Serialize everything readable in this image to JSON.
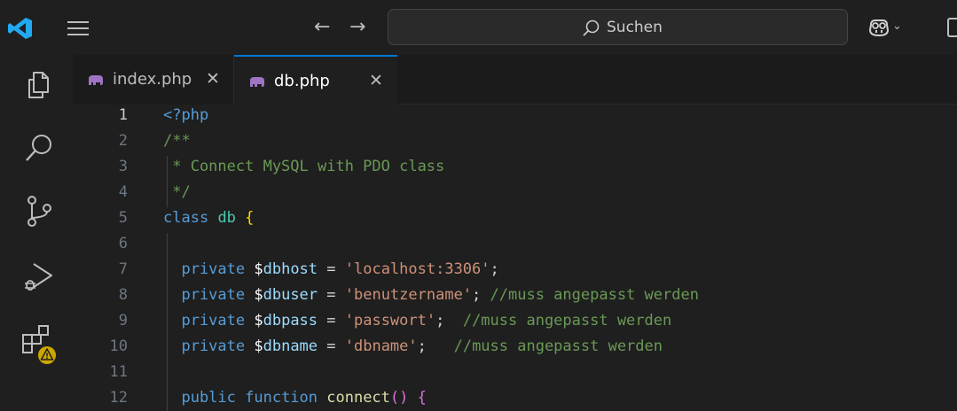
{
  "titlebar": {
    "back_arrow": "←",
    "forward_arrow": "→",
    "search_label": "Suchen",
    "copilot_chevron": "⌄"
  },
  "tabs": [
    {
      "label": "index.php",
      "close": "✕",
      "active": false
    },
    {
      "label": "db.php",
      "close": "✕",
      "active": true
    }
  ],
  "editor": {
    "active_line": 1,
    "lines": [
      {
        "number": "1",
        "tokens": [
          {
            "t": "<?php",
            "c": "tag"
          }
        ]
      },
      {
        "number": "2",
        "tokens": [
          {
            "t": "/**",
            "c": "com"
          }
        ]
      },
      {
        "number": "3",
        "tokens": [
          {
            "t": " * Connect MySQL with PDO class",
            "c": "com"
          }
        ]
      },
      {
        "number": "4",
        "tokens": [
          {
            "t": " */",
            "c": "com"
          }
        ]
      },
      {
        "number": "5",
        "tokens": [
          {
            "t": "class",
            "c": "kw"
          },
          {
            "t": " ",
            "c": "op"
          },
          {
            "t": "db",
            "c": "cls"
          },
          {
            "t": " ",
            "c": "op"
          },
          {
            "t": "{",
            "c": "brace"
          }
        ]
      },
      {
        "number": "6",
        "tokens": []
      },
      {
        "number": "7",
        "tokens": [
          {
            "t": "  private ",
            "c": "kw"
          },
          {
            "t": "$",
            "c": "dollar"
          },
          {
            "t": "dbhost",
            "c": "var"
          },
          {
            "t": " = ",
            "c": "op"
          },
          {
            "t": "'localhost:3306'",
            "c": "str"
          },
          {
            "t": ";",
            "c": "op"
          }
        ]
      },
      {
        "number": "8",
        "tokens": [
          {
            "t": "  private ",
            "c": "kw"
          },
          {
            "t": "$",
            "c": "dollar"
          },
          {
            "t": "dbuser",
            "c": "var"
          },
          {
            "t": " = ",
            "c": "op"
          },
          {
            "t": "'benutzername'",
            "c": "str"
          },
          {
            "t": "; ",
            "c": "op"
          },
          {
            "t": "//muss angepasst werden",
            "c": "com"
          }
        ]
      },
      {
        "number": "9",
        "tokens": [
          {
            "t": "  private ",
            "c": "kw"
          },
          {
            "t": "$",
            "c": "dollar"
          },
          {
            "t": "dbpass",
            "c": "var"
          },
          {
            "t": " = ",
            "c": "op"
          },
          {
            "t": "'passwort'",
            "c": "str"
          },
          {
            "t": ";  ",
            "c": "op"
          },
          {
            "t": "//muss angepasst werden",
            "c": "com"
          }
        ]
      },
      {
        "number": "10",
        "tokens": [
          {
            "t": "  private ",
            "c": "kw"
          },
          {
            "t": "$",
            "c": "dollar"
          },
          {
            "t": "dbname",
            "c": "var"
          },
          {
            "t": " = ",
            "c": "op"
          },
          {
            "t": "'dbname'",
            "c": "str"
          },
          {
            "t": ";   ",
            "c": "op"
          },
          {
            "t": "//muss angepasst werden",
            "c": "com"
          }
        ]
      },
      {
        "number": "11",
        "tokens": []
      },
      {
        "number": "12",
        "tokens": [
          {
            "t": "  public ",
            "c": "kw"
          },
          {
            "t": "function ",
            "c": "kw"
          },
          {
            "t": "connect",
            "c": "fn"
          },
          {
            "t": "()",
            "c": "paren"
          },
          {
            "t": " ",
            "c": "op"
          },
          {
            "t": "{",
            "c": "paren"
          }
        ]
      }
    ]
  },
  "colors": {
    "accent": "#0078d4",
    "vscode_blue": "#23a9f2",
    "php_purple": "#a074c4",
    "warning": "#cca700"
  },
  "icons": {
    "logo": "vscode-logo-icon",
    "menu": "hamburger-menu-icon",
    "search": "search-icon",
    "copilot": "copilot-icon",
    "layout": "layout-icon",
    "explorer": "explorer-icon",
    "search_view": "search-icon",
    "source_control": "source-control-icon",
    "run_debug": "run-debug-icon",
    "extensions": "extensions-icon",
    "warning_badge": "warning-badge-icon",
    "php_file": "php-elephant-icon"
  }
}
